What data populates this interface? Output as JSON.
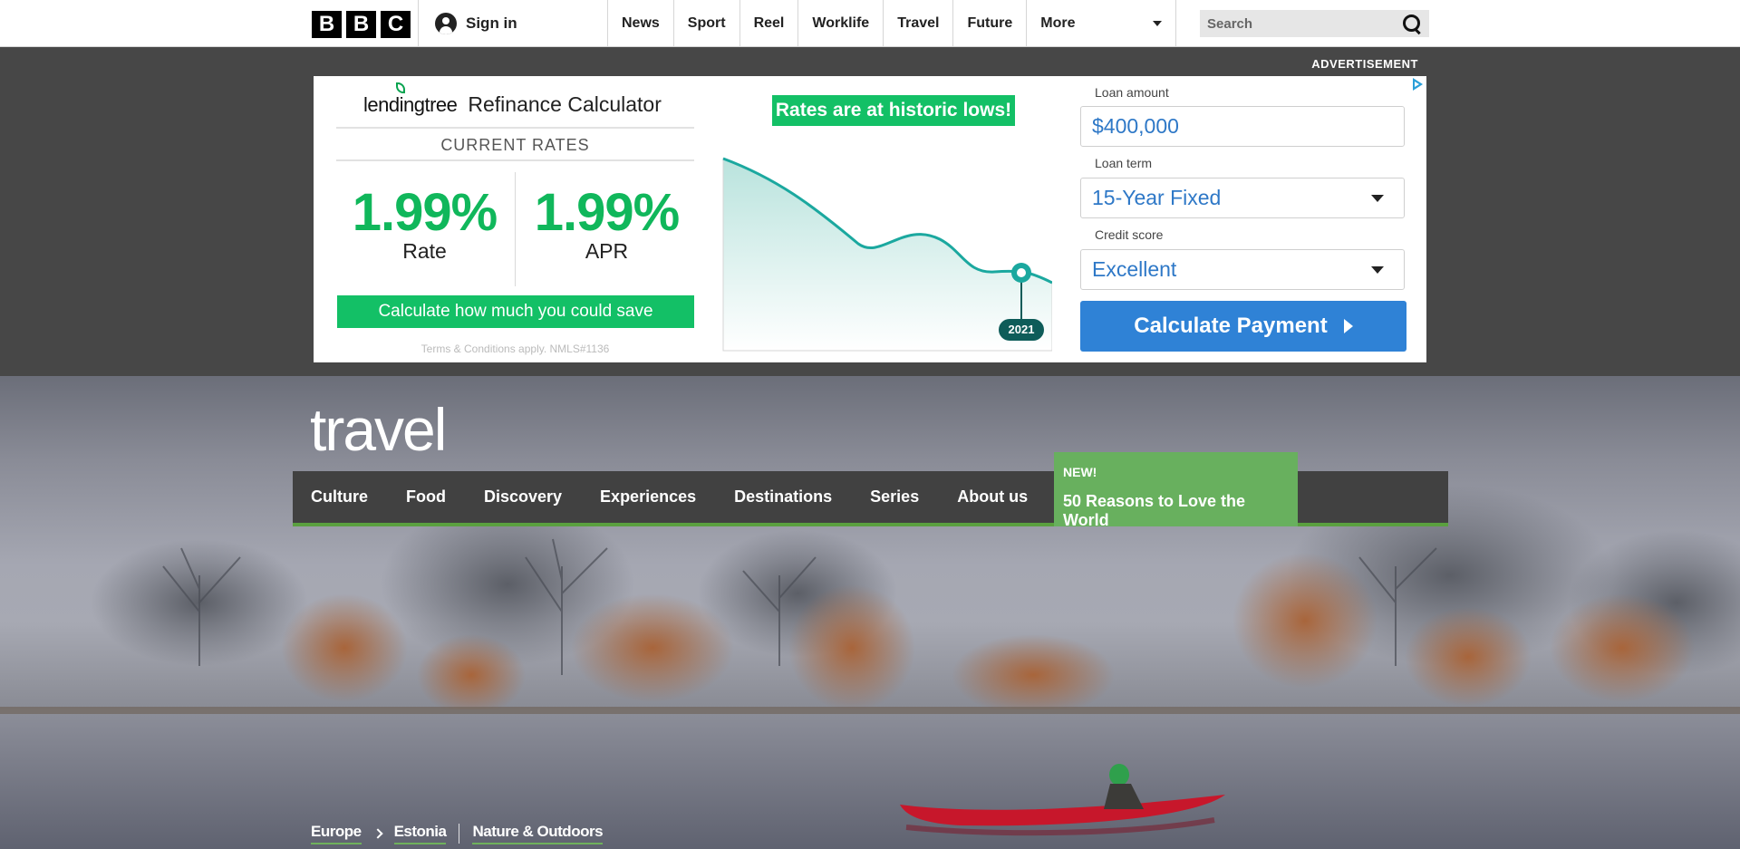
{
  "bbc": {
    "logo_letters": [
      "B",
      "B",
      "C"
    ],
    "signin_label": "Sign in",
    "nav": [
      "News",
      "Sport",
      "Reel",
      "Worklife",
      "Travel",
      "Future"
    ],
    "more_label": "More",
    "search_placeholder": "Search"
  },
  "ad": {
    "label": "ADVERTISEMENT",
    "brand": "lendingtree",
    "product": "Refinance Calculator",
    "current_rates_label": "CURRENT RATES",
    "rate_value": "1.99%",
    "rate_label": "Rate",
    "apr_value": "1.99%",
    "apr_label": "APR",
    "cta_save": "Calculate how much you could save",
    "terms": "Terms & Conditions apply. NMLS#1136",
    "headline": "Rates are at historic lows!",
    "chart_year": "2021",
    "loan_amount_label": "Loan amount",
    "loan_amount_value": "$400,000",
    "loan_term_label": "Loan term",
    "loan_term_value": "15-Year Fixed",
    "credit_label": "Credit score",
    "credit_value": "Excellent",
    "calc_button": "Calculate Payment",
    "colors": {
      "green": "#13c066",
      "blue": "#2f82d6",
      "teal": "#1ba89f"
    }
  },
  "travel": {
    "title": "travel",
    "nav": [
      "Culture",
      "Food",
      "Discovery",
      "Experiences",
      "Destinations",
      "Series",
      "About us"
    ],
    "new_tag": "NEW!",
    "new_title": "50 Reasons to Love the World",
    "breadcrumbs": [
      "Europe",
      "Estonia",
      "Nature & Outdoors"
    ],
    "colors": {
      "accent": "#68b05e",
      "nav_bg": "#414141"
    }
  }
}
